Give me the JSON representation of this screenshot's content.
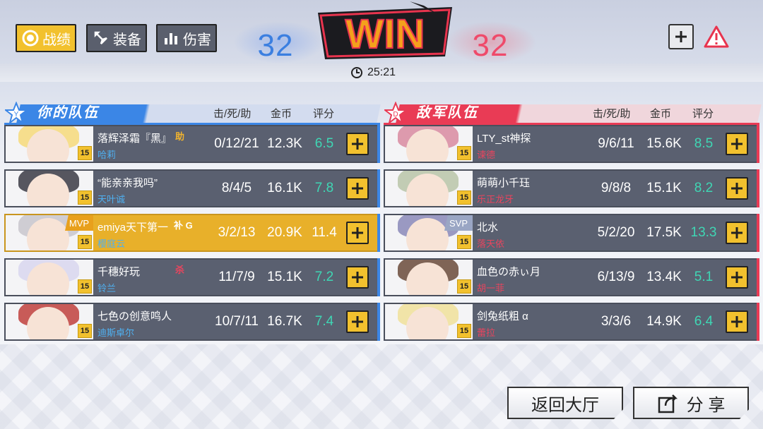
{
  "tabs": [
    {
      "label": "战绩",
      "icon": "record-icon",
      "active": true
    },
    {
      "label": "装备",
      "icon": "equipment-icon",
      "active": false
    },
    {
      "label": "伤害",
      "icon": "damage-chart-icon",
      "active": false
    }
  ],
  "score": {
    "blue": "32",
    "red": "32"
  },
  "result": "WIN",
  "timer": "25:21",
  "columns": {
    "kda": "击/死/助",
    "gold": "金币",
    "rating": "评分"
  },
  "teams": {
    "ally": {
      "title": "你的队伍",
      "players": [
        {
          "name": "落辉泽霜『黑』",
          "tag": "助",
          "tag_color": "#f2b42e",
          "hero": "哈莉",
          "level": "15",
          "kda": "0/12/21",
          "gold": "12.3K",
          "rating": "6.5",
          "mvp": false,
          "portrait": "#f6d97a"
        },
        {
          "name": "“能亲亲我吗”",
          "tag": "",
          "tag_color": "",
          "hero": "天叶诚",
          "level": "15",
          "kda": "8/4/5",
          "gold": "16.1K",
          "rating": "7.8",
          "mvp": false,
          "portrait": "#3a3a44"
        },
        {
          "name": "emiya天下第一",
          "tag": "补 G",
          "tag_color": "#ffffff",
          "hero": "樱庭云",
          "level": "15",
          "kda": "3/2/13",
          "gold": "20.9K",
          "rating": "11.4",
          "mvp": true,
          "badge": "MVP",
          "portrait": "#c8c6cc"
        },
        {
          "name": "千穗好玩",
          "tag": "杀",
          "tag_color": "#e8455e",
          "hero": "铃兰",
          "level": "15",
          "kda": "11/7/9",
          "gold": "15.1K",
          "rating": "7.2",
          "mvp": false,
          "portrait": "#d8d6ee"
        },
        {
          "name": "七色の创意鸣人",
          "tag": "",
          "tag_color": "",
          "hero": "迪斯卓尔",
          "level": "15",
          "kda": "10/7/11",
          "gold": "16.7K",
          "rating": "7.4",
          "mvp": false,
          "portrait": "#c0403c"
        }
      ]
    },
    "enemy": {
      "title": "敌军队伍",
      "players": [
        {
          "name": "LTY_st神探",
          "tag": "",
          "hero": "谏德",
          "level": "15",
          "kda": "9/6/11",
          "gold": "15.6K",
          "rating": "8.5",
          "portrait": "#d88aa0"
        },
        {
          "name": "萌萌小千珏",
          "tag": "",
          "hero": "乐正龙牙",
          "level": "15",
          "kda": "9/8/8",
          "gold": "15.1K",
          "rating": "8.2",
          "portrait": "#b8c4a8"
        },
        {
          "name": "北水",
          "tag": "",
          "hero": "落天依",
          "level": "15",
          "kda": "5/2/20",
          "gold": "17.5K",
          "rating": "13.3",
          "badge": "SVP",
          "portrait": "#8a88b8"
        },
        {
          "name": "血色の赤ぃ月",
          "tag": "",
          "hero": "胡一菲",
          "level": "15",
          "kda": "6/13/9",
          "gold": "13.4K",
          "rating": "5.1",
          "portrait": "#6a4a3a"
        },
        {
          "name": "剑兔纸粗 α",
          "tag": "",
          "hero": "蕾拉",
          "level": "15",
          "kda": "3/3/6",
          "gold": "14.9K",
          "rating": "6.4",
          "portrait": "#f0e09a"
        }
      ]
    }
  },
  "buttons": {
    "lobby": "返回大厅",
    "share": "分 享"
  },
  "colors": {
    "ally": "#3b86e6",
    "enemy": "#e93b55",
    "gold": "#f2c12e",
    "rating": "#3fd6b4"
  }
}
